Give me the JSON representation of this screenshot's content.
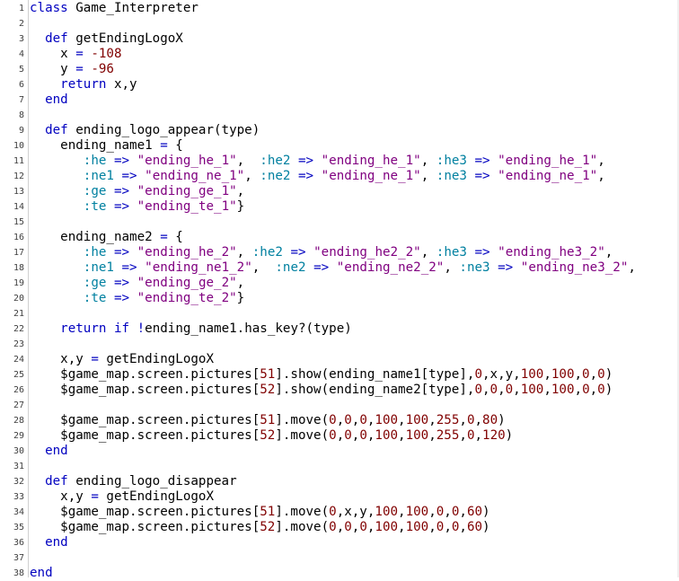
{
  "colors": {
    "keyword": "#0000c0",
    "number": "#800000",
    "string": "#800080",
    "symbol": "#0080a0",
    "variable": "#000080",
    "plain": "#000000"
  },
  "lines": [
    {
      "n": "1",
      "tokens": [
        [
          "kw",
          "class"
        ],
        [
          "p",
          " Game_Interpreter"
        ]
      ]
    },
    {
      "n": "2",
      "tokens": []
    },
    {
      "n": "3",
      "tokens": [
        [
          "p",
          "  "
        ],
        [
          "kw",
          "def"
        ],
        [
          "p",
          " getEndingLogoX"
        ]
      ]
    },
    {
      "n": "4",
      "tokens": [
        [
          "p",
          "    x "
        ],
        [
          "kw",
          "="
        ],
        [
          "p",
          " "
        ],
        [
          "num",
          "-108"
        ]
      ]
    },
    {
      "n": "5",
      "tokens": [
        [
          "p",
          "    y "
        ],
        [
          "kw",
          "="
        ],
        [
          "p",
          " "
        ],
        [
          "num",
          "-96"
        ]
      ]
    },
    {
      "n": "6",
      "tokens": [
        [
          "p",
          "    "
        ],
        [
          "kw",
          "return"
        ],
        [
          "p",
          " x,y"
        ]
      ]
    },
    {
      "n": "7",
      "tokens": [
        [
          "p",
          "  "
        ],
        [
          "kw",
          "end"
        ]
      ]
    },
    {
      "n": "8",
      "tokens": []
    },
    {
      "n": "9",
      "tokens": [
        [
          "p",
          "  "
        ],
        [
          "kw",
          "def"
        ],
        [
          "p",
          " ending_logo_appear(type)"
        ]
      ]
    },
    {
      "n": "10",
      "tokens": [
        [
          "p",
          "    ending_name1 "
        ],
        [
          "kw",
          "="
        ],
        [
          "p",
          " {"
        ]
      ]
    },
    {
      "n": "11",
      "tokens": [
        [
          "p",
          "       "
        ],
        [
          "sym",
          ":he"
        ],
        [
          "p",
          " "
        ],
        [
          "kw",
          "=>"
        ],
        [
          "p",
          " "
        ],
        [
          "str",
          "\"ending_he_1\""
        ],
        [
          "p",
          ",  "
        ],
        [
          "sym",
          ":he2"
        ],
        [
          "p",
          " "
        ],
        [
          "kw",
          "=>"
        ],
        [
          "p",
          " "
        ],
        [
          "str",
          "\"ending_he_1\""
        ],
        [
          "p",
          ", "
        ],
        [
          "sym",
          ":he3"
        ],
        [
          "p",
          " "
        ],
        [
          "kw",
          "=>"
        ],
        [
          "p",
          " "
        ],
        [
          "str",
          "\"ending_he_1\""
        ],
        [
          "p",
          ","
        ]
      ]
    },
    {
      "n": "12",
      "tokens": [
        [
          "p",
          "       "
        ],
        [
          "sym",
          ":ne1"
        ],
        [
          "p",
          " "
        ],
        [
          "kw",
          "=>"
        ],
        [
          "p",
          " "
        ],
        [
          "str",
          "\"ending_ne_1\""
        ],
        [
          "p",
          ", "
        ],
        [
          "sym",
          ":ne2"
        ],
        [
          "p",
          " "
        ],
        [
          "kw",
          "=>"
        ],
        [
          "p",
          " "
        ],
        [
          "str",
          "\"ending_ne_1\""
        ],
        [
          "p",
          ", "
        ],
        [
          "sym",
          ":ne3"
        ],
        [
          "p",
          " "
        ],
        [
          "kw",
          "=>"
        ],
        [
          "p",
          " "
        ],
        [
          "str",
          "\"ending_ne_1\""
        ],
        [
          "p",
          ","
        ]
      ]
    },
    {
      "n": "13",
      "tokens": [
        [
          "p",
          "       "
        ],
        [
          "sym",
          ":ge"
        ],
        [
          "p",
          " "
        ],
        [
          "kw",
          "=>"
        ],
        [
          "p",
          " "
        ],
        [
          "str",
          "\"ending_ge_1\""
        ],
        [
          "p",
          ","
        ]
      ]
    },
    {
      "n": "14",
      "tokens": [
        [
          "p",
          "       "
        ],
        [
          "sym",
          ":te"
        ],
        [
          "p",
          " "
        ],
        [
          "kw",
          "=>"
        ],
        [
          "p",
          " "
        ],
        [
          "str",
          "\"ending_te_1\""
        ],
        [
          "p",
          "}"
        ]
      ]
    },
    {
      "n": "15",
      "tokens": []
    },
    {
      "n": "16",
      "tokens": [
        [
          "p",
          "    ending_name2 "
        ],
        [
          "kw",
          "="
        ],
        [
          "p",
          " {"
        ]
      ]
    },
    {
      "n": "17",
      "tokens": [
        [
          "p",
          "       "
        ],
        [
          "sym",
          ":he"
        ],
        [
          "p",
          " "
        ],
        [
          "kw",
          "=>"
        ],
        [
          "p",
          " "
        ],
        [
          "str",
          "\"ending_he_2\""
        ],
        [
          "p",
          ", "
        ],
        [
          "sym",
          ":he2"
        ],
        [
          "p",
          " "
        ],
        [
          "kw",
          "=>"
        ],
        [
          "p",
          " "
        ],
        [
          "str",
          "\"ending_he2_2\""
        ],
        [
          "p",
          ", "
        ],
        [
          "sym",
          ":he3"
        ],
        [
          "p",
          " "
        ],
        [
          "kw",
          "=>"
        ],
        [
          "p",
          " "
        ],
        [
          "str",
          "\"ending_he3_2\""
        ],
        [
          "p",
          ","
        ]
      ]
    },
    {
      "n": "18",
      "tokens": [
        [
          "p",
          "       "
        ],
        [
          "sym",
          ":ne1"
        ],
        [
          "p",
          " "
        ],
        [
          "kw",
          "=>"
        ],
        [
          "p",
          " "
        ],
        [
          "str",
          "\"ending_ne1_2\""
        ],
        [
          "p",
          ",  "
        ],
        [
          "sym",
          ":ne2"
        ],
        [
          "p",
          " "
        ],
        [
          "kw",
          "=>"
        ],
        [
          "p",
          " "
        ],
        [
          "str",
          "\"ending_ne2_2\""
        ],
        [
          "p",
          ", "
        ],
        [
          "sym",
          ":ne3"
        ],
        [
          "p",
          " "
        ],
        [
          "kw",
          "=>"
        ],
        [
          "p",
          " "
        ],
        [
          "str",
          "\"ending_ne3_2\""
        ],
        [
          "p",
          ","
        ]
      ]
    },
    {
      "n": "19",
      "tokens": [
        [
          "p",
          "       "
        ],
        [
          "sym",
          ":ge"
        ],
        [
          "p",
          " "
        ],
        [
          "kw",
          "=>"
        ],
        [
          "p",
          " "
        ],
        [
          "str",
          "\"ending_ge_2\""
        ],
        [
          "p",
          ","
        ]
      ]
    },
    {
      "n": "20",
      "tokens": [
        [
          "p",
          "       "
        ],
        [
          "sym",
          ":te"
        ],
        [
          "p",
          " "
        ],
        [
          "kw",
          "=>"
        ],
        [
          "p",
          " "
        ],
        [
          "str",
          "\"ending_te_2\""
        ],
        [
          "p",
          "}"
        ]
      ]
    },
    {
      "n": "21",
      "tokens": []
    },
    {
      "n": "22",
      "tokens": [
        [
          "p",
          "    "
        ],
        [
          "kw",
          "return"
        ],
        [
          "p",
          " "
        ],
        [
          "kw",
          "if"
        ],
        [
          "p",
          " "
        ],
        [
          "kw",
          "!"
        ],
        [
          "p",
          "ending_name1.has_key?(type)"
        ]
      ]
    },
    {
      "n": "23",
      "tokens": []
    },
    {
      "n": "24",
      "tokens": [
        [
          "p",
          "    x,y "
        ],
        [
          "kw",
          "="
        ],
        [
          "p",
          " getEndingLogoX"
        ]
      ]
    },
    {
      "n": "25",
      "tokens": [
        [
          "p",
          "    $game_map.screen.pictures["
        ],
        [
          "num",
          "51"
        ],
        [
          "p",
          "].show(ending_name1[type],"
        ],
        [
          "num",
          "0"
        ],
        [
          "p",
          ",x,y,"
        ],
        [
          "num",
          "100"
        ],
        [
          "p",
          ","
        ],
        [
          "num",
          "100"
        ],
        [
          "p",
          ","
        ],
        [
          "num",
          "0"
        ],
        [
          "p",
          ","
        ],
        [
          "num",
          "0"
        ],
        [
          "p",
          ")"
        ]
      ]
    },
    {
      "n": "26",
      "tokens": [
        [
          "p",
          "    $game_map.screen.pictures["
        ],
        [
          "num",
          "52"
        ],
        [
          "p",
          "].show(ending_name2[type],"
        ],
        [
          "num",
          "0"
        ],
        [
          "p",
          ","
        ],
        [
          "num",
          "0"
        ],
        [
          "p",
          ","
        ],
        [
          "num",
          "0"
        ],
        [
          "p",
          ","
        ],
        [
          "num",
          "100"
        ],
        [
          "p",
          ","
        ],
        [
          "num",
          "100"
        ],
        [
          "p",
          ","
        ],
        [
          "num",
          "0"
        ],
        [
          "p",
          ","
        ],
        [
          "num",
          "0"
        ],
        [
          "p",
          ")"
        ]
      ]
    },
    {
      "n": "27",
      "tokens": []
    },
    {
      "n": "28",
      "tokens": [
        [
          "p",
          "    $game_map.screen.pictures["
        ],
        [
          "num",
          "51"
        ],
        [
          "p",
          "].move("
        ],
        [
          "num",
          "0"
        ],
        [
          "p",
          ","
        ],
        [
          "num",
          "0"
        ],
        [
          "p",
          ","
        ],
        [
          "num",
          "0"
        ],
        [
          "p",
          ","
        ],
        [
          "num",
          "100"
        ],
        [
          "p",
          ","
        ],
        [
          "num",
          "100"
        ],
        [
          "p",
          ","
        ],
        [
          "num",
          "255"
        ],
        [
          "p",
          ","
        ],
        [
          "num",
          "0"
        ],
        [
          "p",
          ","
        ],
        [
          "num",
          "80"
        ],
        [
          "p",
          ")"
        ]
      ]
    },
    {
      "n": "29",
      "tokens": [
        [
          "p",
          "    $game_map.screen.pictures["
        ],
        [
          "num",
          "52"
        ],
        [
          "p",
          "].move("
        ],
        [
          "num",
          "0"
        ],
        [
          "p",
          ","
        ],
        [
          "num",
          "0"
        ],
        [
          "p",
          ","
        ],
        [
          "num",
          "0"
        ],
        [
          "p",
          ","
        ],
        [
          "num",
          "100"
        ],
        [
          "p",
          ","
        ],
        [
          "num",
          "100"
        ],
        [
          "p",
          ","
        ],
        [
          "num",
          "255"
        ],
        [
          "p",
          ","
        ],
        [
          "num",
          "0"
        ],
        [
          "p",
          ","
        ],
        [
          "num",
          "120"
        ],
        [
          "p",
          ")"
        ]
      ]
    },
    {
      "n": "30",
      "tokens": [
        [
          "p",
          "  "
        ],
        [
          "kw",
          "end"
        ]
      ]
    },
    {
      "n": "31",
      "tokens": []
    },
    {
      "n": "32",
      "tokens": [
        [
          "p",
          "  "
        ],
        [
          "kw",
          "def"
        ],
        [
          "p",
          " ending_logo_disappear"
        ]
      ]
    },
    {
      "n": "33",
      "tokens": [
        [
          "p",
          "    x,y "
        ],
        [
          "kw",
          "="
        ],
        [
          "p",
          " getEndingLogoX"
        ]
      ]
    },
    {
      "n": "34",
      "tokens": [
        [
          "p",
          "    $game_map.screen.pictures["
        ],
        [
          "num",
          "51"
        ],
        [
          "p",
          "].move("
        ],
        [
          "num",
          "0"
        ],
        [
          "p",
          ",x,y,"
        ],
        [
          "num",
          "100"
        ],
        [
          "p",
          ","
        ],
        [
          "num",
          "100"
        ],
        [
          "p",
          ","
        ],
        [
          "num",
          "0"
        ],
        [
          "p",
          ","
        ],
        [
          "num",
          "0"
        ],
        [
          "p",
          ","
        ],
        [
          "num",
          "60"
        ],
        [
          "p",
          ")"
        ]
      ]
    },
    {
      "n": "35",
      "tokens": [
        [
          "p",
          "    $game_map.screen.pictures["
        ],
        [
          "num",
          "52"
        ],
        [
          "p",
          "].move("
        ],
        [
          "num",
          "0"
        ],
        [
          "p",
          ","
        ],
        [
          "num",
          "0"
        ],
        [
          "p",
          ","
        ],
        [
          "num",
          "0"
        ],
        [
          "p",
          ","
        ],
        [
          "num",
          "100"
        ],
        [
          "p",
          ","
        ],
        [
          "num",
          "100"
        ],
        [
          "p",
          ","
        ],
        [
          "num",
          "0"
        ],
        [
          "p",
          ","
        ],
        [
          "num",
          "0"
        ],
        [
          "p",
          ","
        ],
        [
          "num",
          "60"
        ],
        [
          "p",
          ")"
        ]
      ]
    },
    {
      "n": "36",
      "tokens": [
        [
          "p",
          "  "
        ],
        [
          "kw",
          "end"
        ]
      ]
    },
    {
      "n": "37",
      "tokens": []
    },
    {
      "n": "38",
      "tokens": [
        [
          "kw",
          "end"
        ]
      ]
    }
  ]
}
